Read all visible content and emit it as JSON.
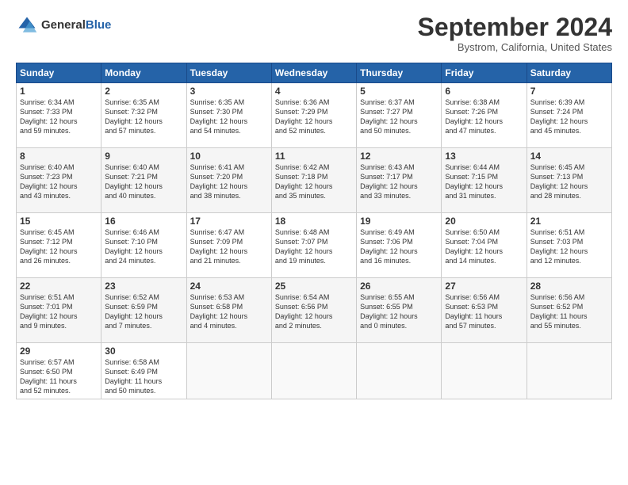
{
  "header": {
    "logo_general": "General",
    "logo_blue": "Blue",
    "month": "September 2024",
    "location": "Bystrom, California, United States"
  },
  "days_of_week": [
    "Sunday",
    "Monday",
    "Tuesday",
    "Wednesday",
    "Thursday",
    "Friday",
    "Saturday"
  ],
  "weeks": [
    [
      {
        "day": "1",
        "info": "Sunrise: 6:34 AM\nSunset: 7:33 PM\nDaylight: 12 hours\nand 59 minutes."
      },
      {
        "day": "2",
        "info": "Sunrise: 6:35 AM\nSunset: 7:32 PM\nDaylight: 12 hours\nand 57 minutes."
      },
      {
        "day": "3",
        "info": "Sunrise: 6:35 AM\nSunset: 7:30 PM\nDaylight: 12 hours\nand 54 minutes."
      },
      {
        "day": "4",
        "info": "Sunrise: 6:36 AM\nSunset: 7:29 PM\nDaylight: 12 hours\nand 52 minutes."
      },
      {
        "day": "5",
        "info": "Sunrise: 6:37 AM\nSunset: 7:27 PM\nDaylight: 12 hours\nand 50 minutes."
      },
      {
        "day": "6",
        "info": "Sunrise: 6:38 AM\nSunset: 7:26 PM\nDaylight: 12 hours\nand 47 minutes."
      },
      {
        "day": "7",
        "info": "Sunrise: 6:39 AM\nSunset: 7:24 PM\nDaylight: 12 hours\nand 45 minutes."
      }
    ],
    [
      {
        "day": "8",
        "info": "Sunrise: 6:40 AM\nSunset: 7:23 PM\nDaylight: 12 hours\nand 43 minutes."
      },
      {
        "day": "9",
        "info": "Sunrise: 6:40 AM\nSunset: 7:21 PM\nDaylight: 12 hours\nand 40 minutes."
      },
      {
        "day": "10",
        "info": "Sunrise: 6:41 AM\nSunset: 7:20 PM\nDaylight: 12 hours\nand 38 minutes."
      },
      {
        "day": "11",
        "info": "Sunrise: 6:42 AM\nSunset: 7:18 PM\nDaylight: 12 hours\nand 35 minutes."
      },
      {
        "day": "12",
        "info": "Sunrise: 6:43 AM\nSunset: 7:17 PM\nDaylight: 12 hours\nand 33 minutes."
      },
      {
        "day": "13",
        "info": "Sunrise: 6:44 AM\nSunset: 7:15 PM\nDaylight: 12 hours\nand 31 minutes."
      },
      {
        "day": "14",
        "info": "Sunrise: 6:45 AM\nSunset: 7:13 PM\nDaylight: 12 hours\nand 28 minutes."
      }
    ],
    [
      {
        "day": "15",
        "info": "Sunrise: 6:45 AM\nSunset: 7:12 PM\nDaylight: 12 hours\nand 26 minutes."
      },
      {
        "day": "16",
        "info": "Sunrise: 6:46 AM\nSunset: 7:10 PM\nDaylight: 12 hours\nand 24 minutes."
      },
      {
        "day": "17",
        "info": "Sunrise: 6:47 AM\nSunset: 7:09 PM\nDaylight: 12 hours\nand 21 minutes."
      },
      {
        "day": "18",
        "info": "Sunrise: 6:48 AM\nSunset: 7:07 PM\nDaylight: 12 hours\nand 19 minutes."
      },
      {
        "day": "19",
        "info": "Sunrise: 6:49 AM\nSunset: 7:06 PM\nDaylight: 12 hours\nand 16 minutes."
      },
      {
        "day": "20",
        "info": "Sunrise: 6:50 AM\nSunset: 7:04 PM\nDaylight: 12 hours\nand 14 minutes."
      },
      {
        "day": "21",
        "info": "Sunrise: 6:51 AM\nSunset: 7:03 PM\nDaylight: 12 hours\nand 12 minutes."
      }
    ],
    [
      {
        "day": "22",
        "info": "Sunrise: 6:51 AM\nSunset: 7:01 PM\nDaylight: 12 hours\nand 9 minutes."
      },
      {
        "day": "23",
        "info": "Sunrise: 6:52 AM\nSunset: 6:59 PM\nDaylight: 12 hours\nand 7 minutes."
      },
      {
        "day": "24",
        "info": "Sunrise: 6:53 AM\nSunset: 6:58 PM\nDaylight: 12 hours\nand 4 minutes."
      },
      {
        "day": "25",
        "info": "Sunrise: 6:54 AM\nSunset: 6:56 PM\nDaylight: 12 hours\nand 2 minutes."
      },
      {
        "day": "26",
        "info": "Sunrise: 6:55 AM\nSunset: 6:55 PM\nDaylight: 12 hours\nand 0 minutes."
      },
      {
        "day": "27",
        "info": "Sunrise: 6:56 AM\nSunset: 6:53 PM\nDaylight: 11 hours\nand 57 minutes."
      },
      {
        "day": "28",
        "info": "Sunrise: 6:56 AM\nSunset: 6:52 PM\nDaylight: 11 hours\nand 55 minutes."
      }
    ],
    [
      {
        "day": "29",
        "info": "Sunrise: 6:57 AM\nSunset: 6:50 PM\nDaylight: 11 hours\nand 52 minutes."
      },
      {
        "day": "30",
        "info": "Sunrise: 6:58 AM\nSunset: 6:49 PM\nDaylight: 11 hours\nand 50 minutes."
      },
      {
        "day": "",
        "info": ""
      },
      {
        "day": "",
        "info": ""
      },
      {
        "day": "",
        "info": ""
      },
      {
        "day": "",
        "info": ""
      },
      {
        "day": "",
        "info": ""
      }
    ]
  ]
}
